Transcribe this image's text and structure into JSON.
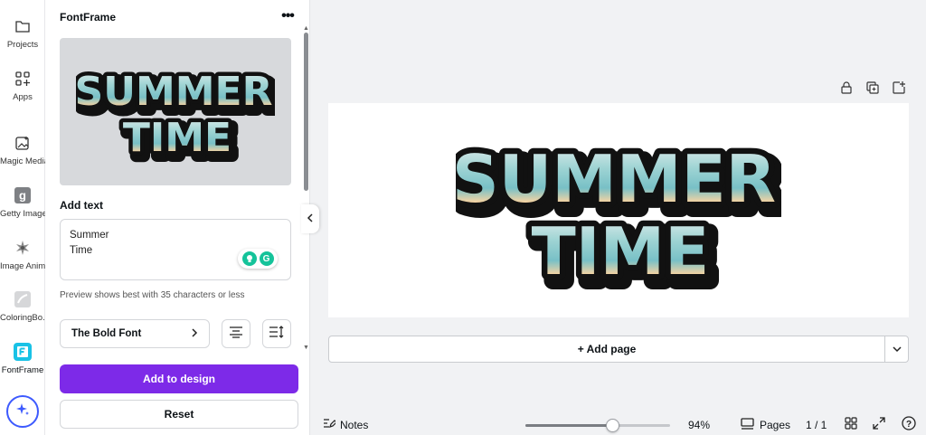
{
  "rail": {
    "items": [
      {
        "label": "Projects",
        "icon": "folder-icon"
      },
      {
        "label": "Apps",
        "icon": "apps-grid-icon"
      },
      {
        "label": "Magic Media",
        "icon": "magic-media-icon"
      },
      {
        "label": "Getty Images",
        "icon": "getty-images-icon"
      },
      {
        "label": "Image Anim...",
        "icon": "image-animate-icon"
      },
      {
        "label": "ColoringBo...",
        "icon": "coloring-book-icon"
      },
      {
        "label": "FontFrame",
        "icon": "fontframe-icon"
      }
    ]
  },
  "panel": {
    "title": "FontFrame",
    "preview": {
      "line1": "SUMMER",
      "line2": "TIME"
    },
    "add_text_label": "Add text",
    "text_value_line1": "Summer",
    "text_value_line2": "Time",
    "hint": "Preview shows best with 35 characters or less",
    "font_name": "The Bold Font",
    "add_button": "Add to design",
    "reset_button": "Reset"
  },
  "canvas": {
    "artwork": {
      "line1": "SUMMER",
      "line2": "TIME"
    },
    "add_page": "+ Add page"
  },
  "bottom": {
    "notes": "Notes",
    "zoom": "94%",
    "zoom_fraction": 0.6,
    "pages": "Pages",
    "page_count": "1 / 1"
  },
  "colors": {
    "accent": "#7d2ae8",
    "fontframe_icon": "#19c2e6"
  }
}
